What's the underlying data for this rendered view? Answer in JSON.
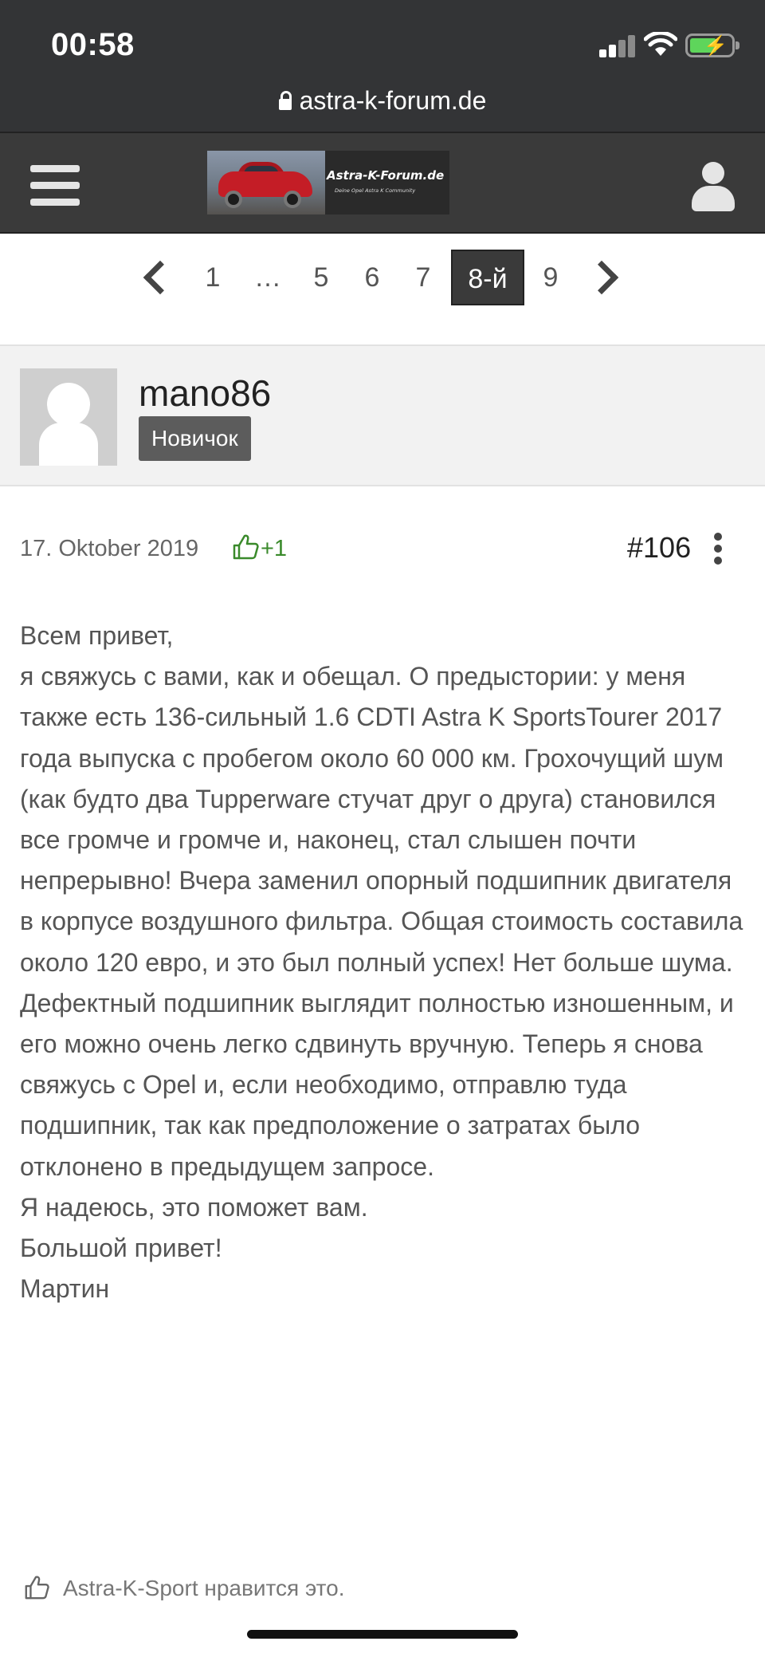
{
  "status_bar": {
    "time": "00:58",
    "url": "astra-k-forum.de"
  },
  "header": {
    "logo_title": "Astra-K-Forum.de",
    "logo_subtitle": "Deine Opel Astra K Community",
    "menu_icon": "hamburger-menu-icon",
    "user_icon": "user-account-icon",
    "colors": {
      "header_bg": "#3a3a3a",
      "statusbar_bg": "#333436"
    }
  },
  "pagination": {
    "prev_icon": "chevron-left-icon",
    "next_icon": "chevron-right-icon",
    "pages": [
      "1",
      "…",
      "5",
      "6",
      "7",
      "8-й",
      "9"
    ],
    "active_page": "8-й"
  },
  "post": {
    "author": "mano86",
    "rank": "Новичок",
    "date": "17. Oktober 2019",
    "reaction": "+1",
    "reaction_icon": "thumbs-up-icon",
    "post_number": "#106",
    "options_icon": "more-vertical-icon",
    "body": [
      "Всем привет,",
      "я свяжусь с вами, как и обещал. О предыстории: у меня также есть 136-сильный 1.6 CDTI Astra K SportsTourer 2017 года выпуска с пробегом около 60 000 км. Грохочущий шум (как будто два Tupperware стучат друг о друга) становился все громче и громче и, наконец, стал слышен почти непрерывно! Вчера заменил опорный подшипник двигателя в корпусе воздушного фильтра. Общая стоимость составила около 120 евро, и это был полный успех! Нет больше шума. Дефектный подшипник выглядит полностью изношенным, и его можно очень легко сдвинуть вручную. Теперь я снова свяжусь с Opel и, если необходимо, отправлю туда подшипник, так как предположение о затратах было отклонено в предыдущем запросе.",
      "Я надеюсь, это поможет вам.",
      "Большой привет!",
      "Мартин"
    ],
    "likes_text": "Astra-K-Sport нравится это.",
    "reaction_color": "#3a8a2b"
  }
}
